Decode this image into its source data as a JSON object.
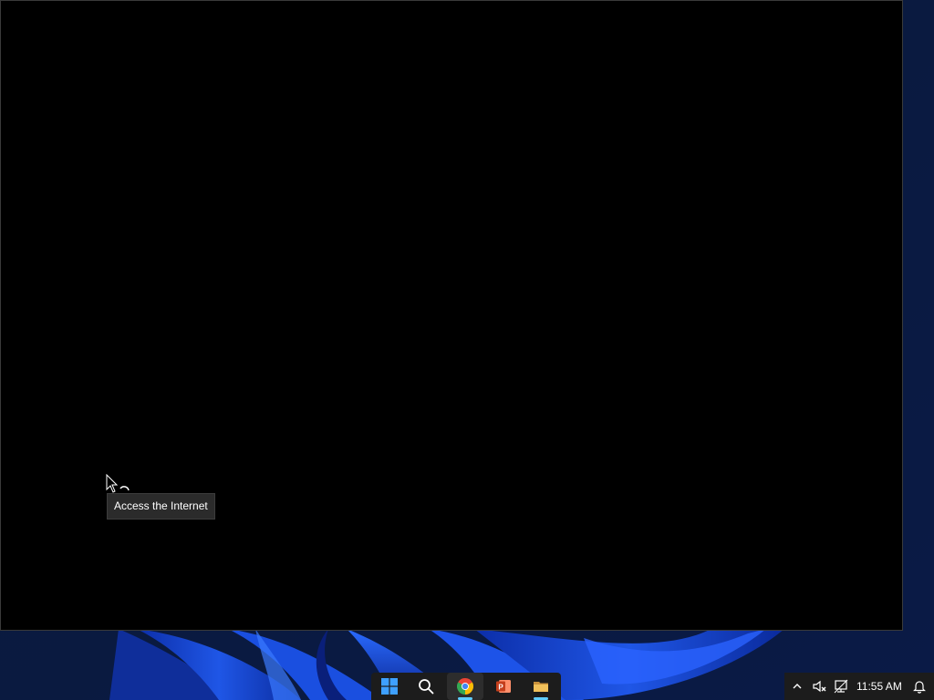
{
  "tooltip": {
    "text": "Access the Internet"
  },
  "taskbar": {
    "apps": [
      {
        "name": "Start",
        "icon": "windows-logo-icon"
      },
      {
        "name": "Search",
        "icon": "search-icon"
      },
      {
        "name": "Google Chrome",
        "icon": "chrome-icon",
        "active": true,
        "running": true
      },
      {
        "name": "PowerPoint",
        "icon": "powerpoint-icon",
        "running": false
      },
      {
        "name": "File Explorer",
        "icon": "folder-icon",
        "running": true
      }
    ],
    "tray": {
      "clock": "11:55 AM",
      "icons": [
        "chevron-up-icon",
        "speaker-muted-icon",
        "network-icon",
        "notification-bell-icon"
      ]
    }
  },
  "colors": {
    "window_bg": "#000000",
    "taskbar_bg": "#1c1c1c",
    "accent": "#60cdff",
    "wallpaper_blue": "#1f4fd8",
    "chrome_red": "#ea4335",
    "chrome_yellow": "#fbbc05",
    "chrome_green": "#34a853",
    "chrome_blue": "#4285f4",
    "powerpoint_red": "#d24726",
    "folder_yellow": "#e8b44b"
  }
}
